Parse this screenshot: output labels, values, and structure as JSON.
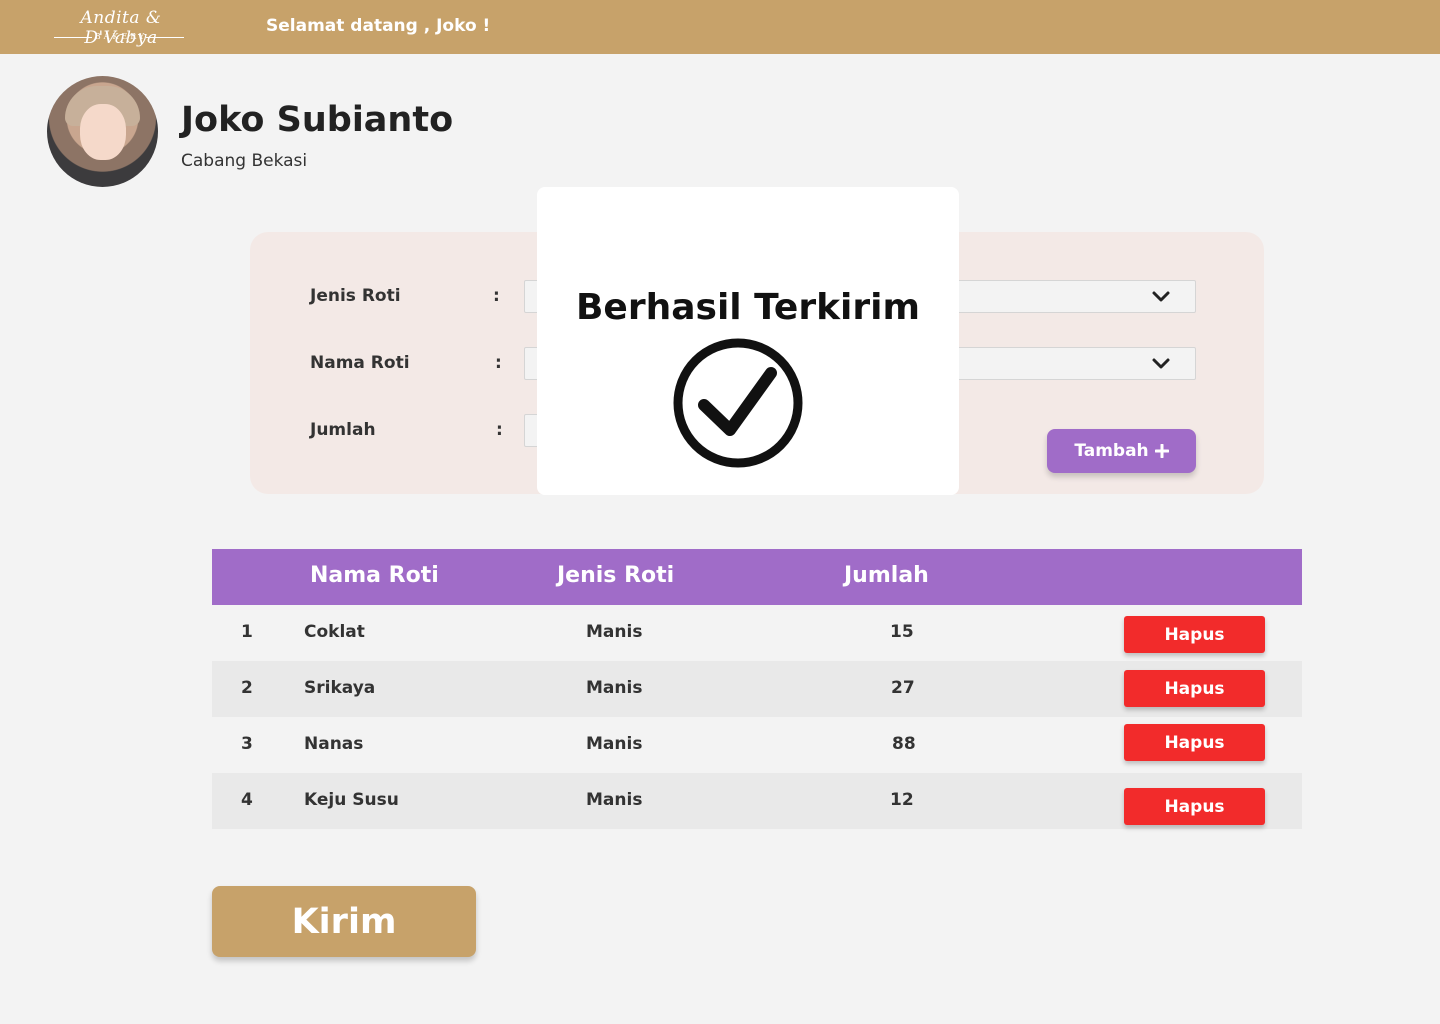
{
  "header": {
    "logo_text": "Andita & D'Vabya",
    "logo_sub": "BAKERY",
    "welcome": "Selamat datang , Joko !"
  },
  "profile": {
    "name": "Joko Subianto",
    "branch": "Cabang Bekasi"
  },
  "form": {
    "jenis_label": "Jenis Roti",
    "nama_label": "Nama Roti",
    "jumlah_label": "Jumlah",
    "colon": ":",
    "add_button": "Tambah"
  },
  "table": {
    "headers": [
      "Nama Roti",
      "Jenis Roti",
      "Jumlah"
    ],
    "rows": [
      {
        "no": "1",
        "nama": "Coklat",
        "jenis": "Manis",
        "jumlah": "15"
      },
      {
        "no": "2",
        "nama": "Srikaya",
        "jenis": "Manis",
        "jumlah": "27"
      },
      {
        "no": "3",
        "nama": "Nanas",
        "jenis": "Manis",
        "jumlah": "88"
      },
      {
        "no": "4",
        "nama": "Keju Susu",
        "jenis": "Manis",
        "jumlah": "12"
      }
    ],
    "delete_label": "Hapus"
  },
  "submit_label": "Kirim",
  "modal": {
    "title": "Berhasil Terkirim",
    "icon": "check-circle-icon"
  },
  "colors": {
    "brand": "#c7a26a",
    "accent": "#a06cc8",
    "danger": "#f22b2b"
  }
}
